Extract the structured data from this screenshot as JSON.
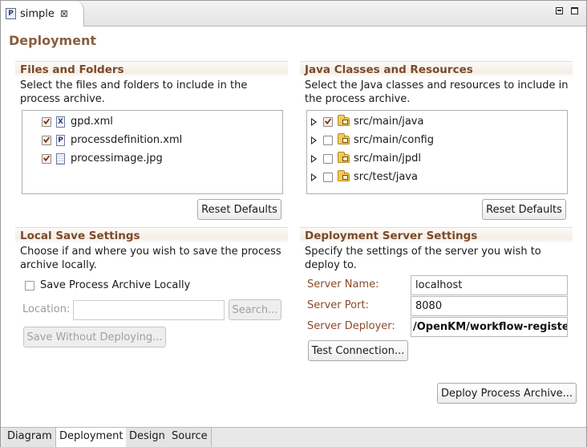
{
  "editor": {
    "tab_label": "simple",
    "tab_icon": "P",
    "close_glyph": "⊠"
  },
  "page": {
    "title": "Deployment"
  },
  "files_folders": {
    "header": "Files and Folders",
    "description": "Select the files and folders to include in the process archive.",
    "items": [
      {
        "label": "gpd.xml",
        "checked": true,
        "icon": "xml-file-icon",
        "glyph": "X"
      },
      {
        "label": "processdefinition.xml",
        "checked": true,
        "icon": "process-definition-file-icon",
        "glyph": "P"
      },
      {
        "label": "processimage.jpg",
        "checked": true,
        "icon": "image-file-icon",
        "glyph": ""
      }
    ],
    "reset_label": "Reset Defaults"
  },
  "java_classes": {
    "header": "Java Classes and Resources",
    "description": "Select the Java classes and resources to include in the process archive.",
    "items": [
      {
        "label": "src/main/java",
        "checked": true
      },
      {
        "label": "src/main/config",
        "checked": false
      },
      {
        "label": "src/main/jpdl",
        "checked": false
      },
      {
        "label": "src/test/java",
        "checked": false
      }
    ],
    "reset_label": "Reset Defaults"
  },
  "local_save": {
    "header": "Local Save Settings",
    "description": "Choose if and where you wish to save the process archive locally.",
    "save_locally_label": "Save Process Archive Locally",
    "save_locally_checked": false,
    "location_label": "Location:",
    "location_value": "",
    "search_label": "Search...",
    "save_without_deploying_label": "Save Without Deploying..."
  },
  "server_settings": {
    "header": "Deployment Server Settings",
    "description": "Specify the settings of the server you wish to deploy to.",
    "server_name_label": "Server Name:",
    "server_name_value": "localhost",
    "server_port_label": "Server Port:",
    "server_port_value": "8080",
    "server_deployer_label": "Server Deployer:",
    "server_deployer_value": "/OpenKM/workflow-register",
    "test_connection_label": "Test Connection..."
  },
  "deploy_label": "Deploy Process Archive...",
  "bottom_tabs": [
    "Diagram",
    "Deployment",
    "Design",
    "Source"
  ],
  "active_bottom_tab": "Deployment",
  "colors": {
    "section_header": "#7b4a2a",
    "page_title": "#8b5e3c",
    "field_label": "#8b4a2a"
  }
}
